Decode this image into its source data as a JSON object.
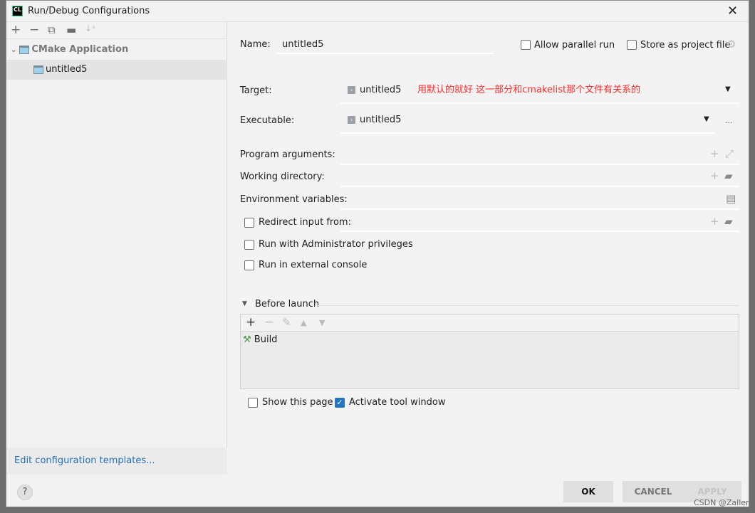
{
  "window": {
    "title": "Run/Debug Configurations",
    "app_icon": "CL"
  },
  "left": {
    "toolbar": [
      "add-icon",
      "remove-icon",
      "copy-icon",
      "new-folder-icon",
      "sort-icon"
    ],
    "tree": [
      {
        "label": "CMake Application",
        "expanded": true
      },
      {
        "label": "untitled5",
        "selected": true
      }
    ],
    "templates_link": "Edit configuration templates..."
  },
  "form": {
    "name_label": "Name:",
    "name_value": "untitled5",
    "allow_parallel": {
      "label": "Allow parallel run",
      "checked": false
    },
    "store_project": {
      "label": "Store as project file",
      "checked": false
    },
    "target_label": "Target:",
    "target_value": "untitled5",
    "annotation": "用默认的就好 这一部分和cmakelist那个文件有关系的",
    "annotation_color": "#ff2a2a",
    "executable_label": "Executable:",
    "executable_value": "untitled5",
    "executable_more": "...",
    "program_args_label": "Program arguments:",
    "working_dir_label": "Working directory:",
    "env_vars_label": "Environment variables:",
    "redirect_input": {
      "label": "Redirect input from:",
      "checked": false
    },
    "admin": {
      "label": "Run with Administrator privileges",
      "checked": false
    },
    "external_console": {
      "label": "Run in external console",
      "checked": false
    },
    "before_launch": {
      "title": "Before launch",
      "items": [
        "Build"
      ]
    },
    "show_page": {
      "label": "Show this page",
      "checked": false
    },
    "activate_tool": {
      "label": "Activate tool window",
      "checked": true
    }
  },
  "buttons": {
    "ok": "OK",
    "cancel": "CANCEL",
    "apply": "APPLY",
    "help": "?"
  },
  "watermark": "CSDN @Zaller",
  "colors": {
    "accent": "#2675bf",
    "link": "#2470b3"
  }
}
